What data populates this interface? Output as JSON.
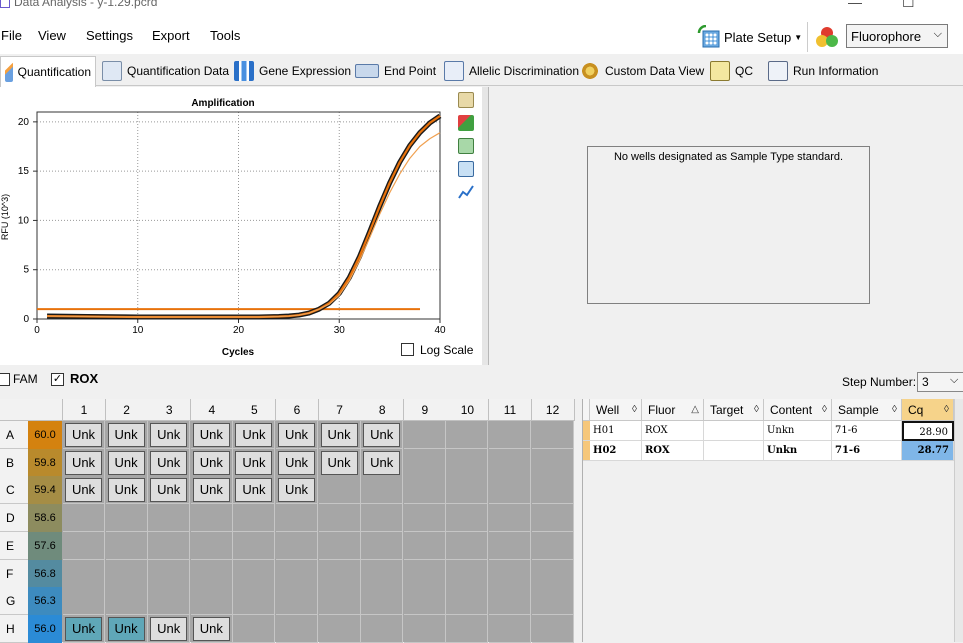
{
  "window": {
    "title": "Data Analysis - y-1.29.pcrd"
  },
  "menu": [
    "File",
    "View",
    "Settings",
    "Export",
    "Tools"
  ],
  "toolbar": {
    "plate_setup": "Plate Setup",
    "fluorophore_select": "Fluorophore"
  },
  "tabs": [
    "Quantification",
    "Quantification Data",
    "Gene Expression",
    "End Point",
    "Allelic Discrimination",
    "Custom Data View",
    "QC",
    "Run Information"
  ],
  "chart_data": {
    "type": "line",
    "title": "Amplification",
    "xlabel": "Cycles",
    "ylabel": "RFU (10^3)",
    "xlim": [
      0,
      40
    ],
    "ylim": [
      0,
      21
    ],
    "xticks": [
      0,
      10,
      20,
      30,
      40
    ],
    "yticks": [
      0,
      5,
      10,
      15,
      20
    ],
    "grid": true,
    "threshold": 1.0,
    "series": [
      {
        "color": "#e8720c",
        "x": [
          1,
          5,
          10,
          15,
          20,
          22,
          24,
          25,
          26,
          27,
          28,
          29,
          30,
          31,
          32,
          33,
          34,
          35,
          36,
          37,
          38,
          39,
          40
        ],
        "values": [
          0.3,
          0.25,
          0.2,
          0.2,
          0.2,
          0.2,
          0.25,
          0.3,
          0.4,
          0.6,
          1.0,
          1.6,
          2.6,
          4.2,
          6.3,
          8.8,
          11.4,
          13.8,
          15.9,
          17.6,
          18.9,
          19.9,
          20.6
        ]
      },
      {
        "color": "#1a1a1a",
        "x": [
          1,
          5,
          10,
          15,
          20,
          22,
          24,
          25,
          26,
          27,
          28,
          29,
          30,
          31,
          32,
          33,
          34,
          35,
          36,
          37,
          38,
          39,
          40
        ],
        "values": [
          0.3,
          0.25,
          0.2,
          0.2,
          0.2,
          0.2,
          0.25,
          0.3,
          0.4,
          0.6,
          1.0,
          1.6,
          2.6,
          4.2,
          6.3,
          8.8,
          11.4,
          13.8,
          15.9,
          17.6,
          18.9,
          19.9,
          20.6
        ]
      },
      {
        "color": "#f0a050",
        "x": [
          1,
          5,
          10,
          15,
          20,
          22,
          24,
          25,
          26,
          27,
          28,
          29,
          30,
          31,
          32,
          33,
          34,
          35,
          36,
          37,
          38,
          39,
          40
        ],
        "values": [
          0.3,
          0.25,
          0.2,
          0.2,
          0.2,
          0.2,
          0.25,
          0.3,
          0.4,
          0.6,
          1.0,
          1.5,
          2.4,
          3.9,
          5.9,
          8.2,
          10.6,
          12.8,
          14.7,
          16.3,
          17.5,
          18.3,
          18.9
        ]
      }
    ]
  },
  "options": {
    "log_scale": "Log Scale"
  },
  "side_panel": {
    "message": "No wells designated as Sample Type standard."
  },
  "fluors": [
    {
      "label": "FAM",
      "checked": false
    },
    {
      "label": "ROX",
      "checked": true
    }
  ],
  "step": {
    "label": "Step Number:",
    "value": "3"
  },
  "plate": {
    "columns": [
      "1",
      "2",
      "3",
      "4",
      "5",
      "6",
      "7",
      "8",
      "9",
      "10",
      "11",
      "12"
    ],
    "rows": [
      {
        "label": "A",
        "temp": "60.0",
        "color": "#d4820f",
        "cells": [
          "Unk",
          "Unk",
          "Unk",
          "Unk",
          "Unk",
          "Unk",
          "Unk",
          "Unk",
          "",
          "",
          "",
          ""
        ]
      },
      {
        "label": "B",
        "temp": "59.8",
        "color": "#b98a2c",
        "cells": [
          "Unk",
          "Unk",
          "Unk",
          "Unk",
          "Unk",
          "Unk",
          "Unk",
          "Unk",
          "",
          "",
          "",
          ""
        ]
      },
      {
        "label": "C",
        "temp": "59.4",
        "color": "#a58d45",
        "cells": [
          "Unk",
          "Unk",
          "Unk",
          "Unk",
          "Unk",
          "Unk",
          "",
          "",
          "",
          "",
          "",
          ""
        ]
      },
      {
        "label": "D",
        "temp": "58.6",
        "color": "#8d8c5f",
        "cells": [
          "",
          "",
          "",
          "",
          "",
          "",
          "",
          "",
          "",
          "",
          "",
          ""
        ]
      },
      {
        "label": "E",
        "temp": "57.6",
        "color": "#6f8b7c",
        "cells": [
          "",
          "",
          "",
          "",
          "",
          "",
          "",
          "",
          "",
          "",
          "",
          ""
        ]
      },
      {
        "label": "F",
        "temp": "56.8",
        "color": "#548ba0",
        "cells": [
          "",
          "",
          "",
          "",
          "",
          "",
          "",
          "",
          "",
          "",
          "",
          ""
        ]
      },
      {
        "label": "G",
        "temp": "56.3",
        "color": "#3d8bbf",
        "cells": [
          "",
          "",
          "",
          "",
          "",
          "",
          "",
          "",
          "",
          "",
          "",
          ""
        ]
      },
      {
        "label": "H",
        "temp": "56.0",
        "color": "#2b8bd6",
        "cells": [
          "Unk",
          "Unk",
          "Unk",
          "Unk",
          "",
          "",
          "",
          "",
          "",
          "",
          "",
          ""
        ],
        "selected": [
          0,
          1
        ]
      }
    ]
  },
  "well_table": {
    "columns": [
      "Well",
      "Fluor",
      "Target",
      "Content",
      "Sample",
      "Cq"
    ],
    "rows": [
      {
        "well": "H01",
        "fluor": "ROX",
        "target": "",
        "content": "Unkn",
        "sample": "71-6",
        "cq": "28.90",
        "bold": false
      },
      {
        "well": "H02",
        "fluor": "ROX",
        "target": "",
        "content": "Unkn",
        "sample": "71-6",
        "cq": "28.77",
        "bold": true
      }
    ]
  }
}
